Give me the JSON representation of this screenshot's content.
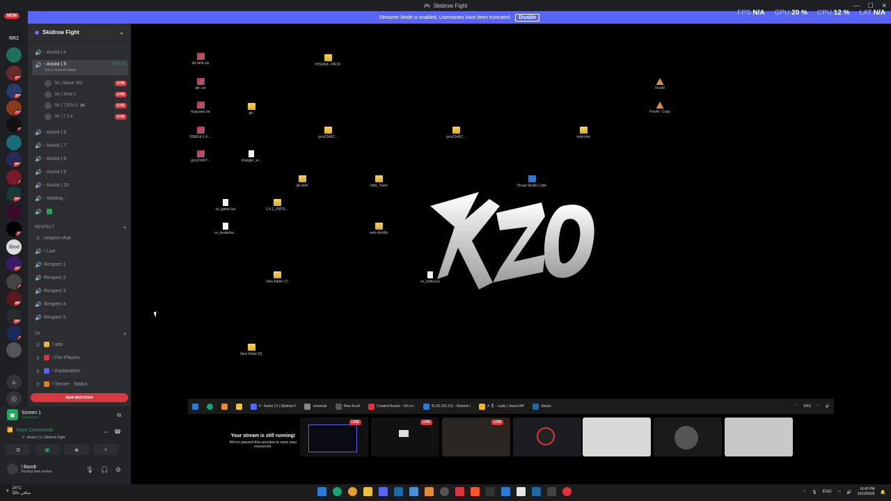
{
  "window": {
    "title": "Skidrow Fight"
  },
  "banner": {
    "text": "Streamer Mode is enabled. Usernames have been truncated.",
    "disable_label": "Disable"
  },
  "stats": {
    "fps_label": "FPS",
    "fps": "N/A",
    "gpu_label": "GPU",
    "gpu": "20 %",
    "cpu_label": "CPU",
    "cpu": "12 %",
    "lat_label": "LAT",
    "lat": "N/A"
  },
  "rail": {
    "new_badge": "NEW",
    "servers": [
      {
        "label": "RR2",
        "badge": "",
        "color": "#313338"
      },
      {
        "label": "",
        "badge": "",
        "color": "#1f6f5f"
      },
      {
        "label": "",
        "badge": "470",
        "color": "#6b2a2a"
      },
      {
        "label": "",
        "badge": "308",
        "color": "#2a3a6b"
      },
      {
        "label": "",
        "badge": "724",
        "color": "#8a3a1a"
      },
      {
        "label": "",
        "badge": "4",
        "color": "#111"
      },
      {
        "label": "",
        "badge": "",
        "color": "#1a6a7a"
      },
      {
        "label": "",
        "badge": "4K+",
        "color": "#2a2a5a"
      },
      {
        "label": "",
        "badge": "1",
        "color": "#7a1a2a"
      },
      {
        "label": "",
        "badge": "5K+",
        "color": "#1a3a3a"
      },
      {
        "label": "",
        "badge": "",
        "color": "#3a0a2a"
      },
      {
        "label": "",
        "badge": "11",
        "color": "#000"
      },
      {
        "label": "3bod",
        "badge": "",
        "color": "#ddd"
      },
      {
        "label": "",
        "badge": "103",
        "color": "#3a1a6a"
      },
      {
        "label": "",
        "badge": "2",
        "color": "#444"
      },
      {
        "label": "",
        "badge": "480",
        "color": "#5a1a1a"
      },
      {
        "label": "",
        "badge": "9K+",
        "color": "#2a2a2a"
      },
      {
        "label": "",
        "badge": "2",
        "color": "#1a2a5a"
      },
      {
        "label": "",
        "badge": "",
        "color": "#555"
      }
    ]
  },
  "sidebar": {
    "server_name": "Skidrow Fight",
    "channels_top": [
      {
        "label": "- Assist | 4"
      }
    ],
    "active_channel": {
      "label": "- Assist | 5",
      "timer": "29:51:23",
      "status": "Set a channel status"
    },
    "users": [
      {
        "name": "SK | Bandr 305",
        "live": "LIVE"
      },
      {
        "name": "SK | 3bod 2",
        "live": "LIVE"
      },
      {
        "name": "SK | 7ZEN 0",
        "tag": "SK",
        "live": "LIVE"
      },
      {
        "name": "SK | T 3 6",
        "live": "LIVE"
      }
    ],
    "channels_mid": [
      {
        "label": "- Assist | 6"
      },
      {
        "label": "- Assist | 7"
      },
      {
        "label": "- Assist | 8"
      },
      {
        "label": "- Assist | 9"
      },
      {
        "label": "- Assist | 10"
      },
      {
        "label": "- Waiting -"
      }
    ],
    "category_respect": "RESPECT",
    "respect_channels": [
      {
        "label": "respect-chat",
        "type": "text"
      },
      {
        "label": "! Live",
        "type": "voice"
      },
      {
        "label": "Respect 1",
        "type": "voice"
      },
      {
        "label": "Respect 2",
        "type": "voice"
      },
      {
        "label": "Respect 3",
        "type": "voice"
      },
      {
        "label": "Respect 4",
        "type": "voice"
      },
      {
        "label": "Respect 5",
        "type": "voice"
      }
    ],
    "category_sk": "SK",
    "sk_channels": [
      {
        "label": "! ads",
        "color": "#f0b232"
      },
      {
        "label": "! For-Players",
        "color": "#da373c"
      },
      {
        "label": "! Explanation",
        "color": "#5865f2"
      },
      {
        "label": "! Server - Status",
        "color": "#e67e22"
      }
    ],
    "new_mentions": "NEW MENTIONS"
  },
  "voice": {
    "screen_title": "Screen 1",
    "screen_sub": "1440p 60FPS",
    "connected": "Voice Connected",
    "connected_sub": "# - Assist | 5 / Skidrow Fight",
    "user_name": "! Bandr",
    "user_status": "Sharing their screen"
  },
  "desktop": {
    "icons": [
      {
        "label": "qb-rank.zip",
        "type": "rar"
      },
      {
        "label": "HISOKA - PACK",
        "type": "folder"
      },
      {
        "label": "qb-.rar",
        "type": "rar"
      },
      {
        "label": "tryspawn.rar",
        "type": "rar"
      },
      {
        "label": "qb-",
        "type": "folder"
      },
      {
        "label": "63b61d-1.4....",
        "type": "rar"
      },
      {
        "label": "grzyClothT...",
        "type": "folder"
      },
      {
        "label": "grzyClothT...",
        "type": "folder"
      },
      {
        "label": "rank-test",
        "type": "folder"
      },
      {
        "label": "grzyClothT...",
        "type": "rar"
      },
      {
        "label": "changer_w...",
        "type": "file"
      },
      {
        "label": "qb-rank",
        "type": "folder"
      },
      {
        "label": "Velix_Team",
        "type": "folder"
      },
      {
        "label": "Visual Studio Code",
        "type": "vs"
      },
      {
        "label": "sv_game.lua",
        "type": "file"
      },
      {
        "label": "1.4.1_YMTE...",
        "type": "folder"
      },
      {
        "label": "sv_leaderbo...",
        "type": "file"
      },
      {
        "label": "rank-dontfix",
        "type": "folder"
      },
      {
        "label": "New folder (7)",
        "type": "folder"
      },
      {
        "label": "sv_lobby.lua",
        "type": "file"
      },
      {
        "label": "New folder (6)",
        "type": "folder"
      },
      {
        "label": "FiveM",
        "type": "app"
      },
      {
        "label": "FiveM - Copy",
        "type": "app"
      }
    ],
    "logo_text": "KZO",
    "taskbar_items": [
      {
        "label": "# - Assist | 5 | Skidrow F",
        "color": "#5865f2"
      },
      {
        "label": "crosshair",
        "color": "#888"
      },
      {
        "label": "Raw Accel",
        "color": "#555"
      },
      {
        "label": "Created Assets - Cfx.re I",
        "color": "#da373c"
      },
      {
        "label": "31.56.120.101 - Remote I",
        "color": "#2b7bd6"
      },
      {
        "label": "# 🎖 - zcply | Sword RP",
        "color": "#f0b232"
      },
      {
        "label": "Steam",
        "color": "#1b6aa8"
      }
    ],
    "taskbar_lang": "ENG"
  },
  "stream": {
    "paused_title": "Your stream is still running!",
    "paused_sub": "We've paused this preview to save your resources.",
    "live_label": "LIVE"
  },
  "taskbar": {
    "weather_temp": "24°C",
    "weather_desc": "صافي غالبًا",
    "lang": "ENG",
    "time": "10:42 PM",
    "date": "10/10/2025"
  }
}
